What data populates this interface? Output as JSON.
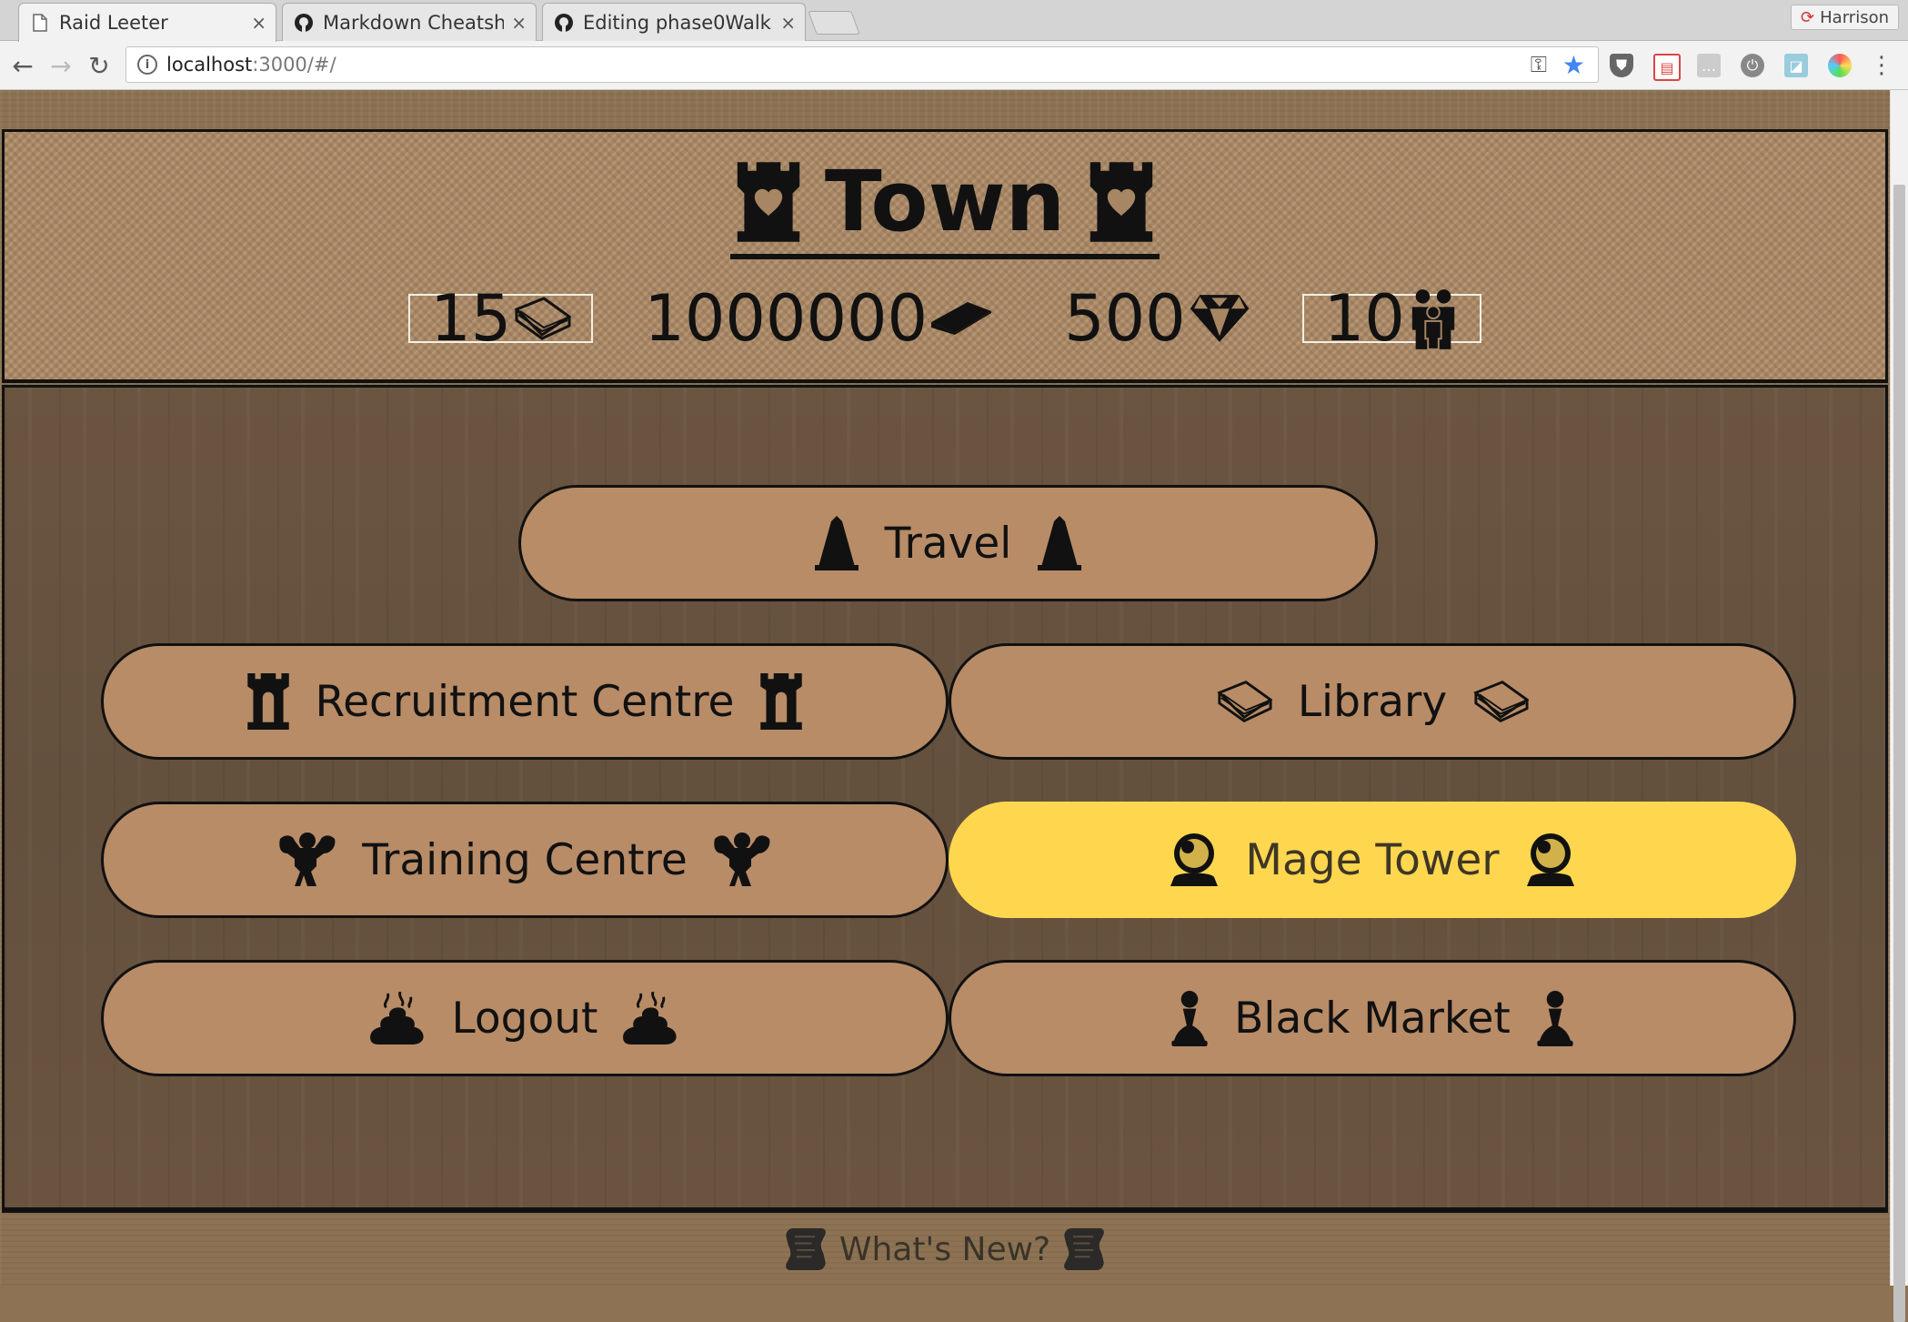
{
  "browser": {
    "tabs": [
      {
        "title": "Raid Leeter",
        "icon": "page-icon",
        "active": true
      },
      {
        "title": "Markdown Cheatsh",
        "icon": "github-icon",
        "active": false
      },
      {
        "title": "Editing phase0Walk",
        "icon": "github-icon",
        "active": false
      }
    ],
    "profile_name": "Harrison",
    "url_host": "localhost",
    "url_path": ":3000/#/"
  },
  "header": {
    "title": "Town",
    "title_icon": "castle-heart-icon",
    "stats": [
      {
        "value": "15",
        "icon": "book-icon",
        "boxed": true
      },
      {
        "value": "1000000",
        "icon": "gold-bar-icon",
        "boxed": false
      },
      {
        "value": "500",
        "icon": "gem-icon",
        "boxed": false
      },
      {
        "value": "10",
        "icon": "people-icon",
        "boxed": true
      }
    ]
  },
  "menu": {
    "travel": {
      "label": "Travel",
      "icon": "cone-icon"
    },
    "recruitment": {
      "label": "Recruitment Centre",
      "icon": "tower-icon"
    },
    "library": {
      "label": "Library",
      "icon": "book-icon"
    },
    "training": {
      "label": "Training Centre",
      "icon": "strongman-icon"
    },
    "mage_tower": {
      "label": "Mage Tower",
      "icon": "crystal-ball-icon",
      "highlighted": true
    },
    "logout": {
      "label": "Logout",
      "icon": "poop-icon"
    },
    "black_market": {
      "label": "Black Market",
      "icon": "pawn-icon"
    }
  },
  "footer": {
    "label": "What's New?",
    "icon": "scroll-icon"
  },
  "colors": {
    "button_bg": "#b88c67",
    "highlight_bg": "#fed74f",
    "outline": "#111111"
  }
}
